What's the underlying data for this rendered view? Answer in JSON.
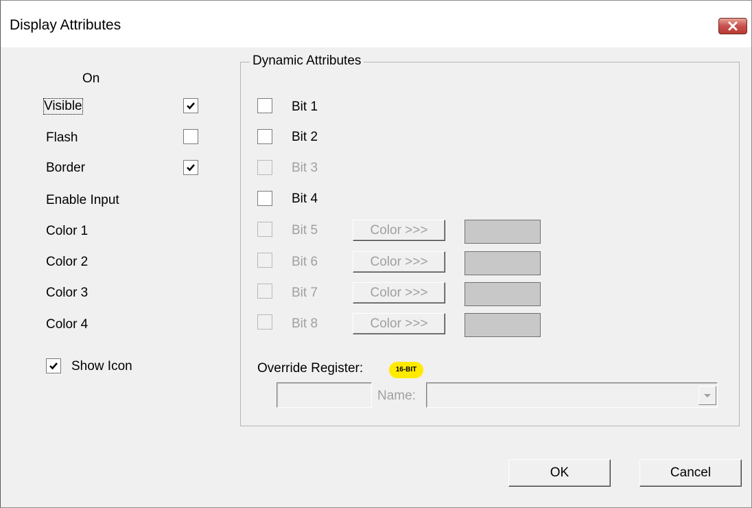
{
  "window": {
    "title": "Display Attributes"
  },
  "left": {
    "on_header": "On",
    "rows": [
      {
        "label": "Visible",
        "checked": true,
        "has_checkbox": true
      },
      {
        "label": "Flash",
        "checked": false,
        "has_checkbox": true
      },
      {
        "label": "Border",
        "checked": true,
        "has_checkbox": true
      },
      {
        "label": "Enable Input",
        "has_checkbox": false
      },
      {
        "label": "Color 1",
        "has_checkbox": false
      },
      {
        "label": "Color 2",
        "has_checkbox": false
      },
      {
        "label": "Color 3",
        "has_checkbox": false
      },
      {
        "label": "Color 4",
        "has_checkbox": false
      }
    ],
    "show_icon": {
      "label": "Show Icon",
      "checked": true
    }
  },
  "dynamic": {
    "title": "Dynamic Attributes",
    "bits": [
      {
        "label": "Bit 1",
        "enabled": true,
        "checked": false
      },
      {
        "label": "Bit 2",
        "enabled": true,
        "checked": false
      },
      {
        "label": "Bit 3",
        "enabled": false,
        "checked": false
      },
      {
        "label": "Bit 4",
        "enabled": true,
        "checked": false
      },
      {
        "label": "Bit 5",
        "enabled": false,
        "checked": false,
        "color_button": "Color >>>"
      },
      {
        "label": "Bit 6",
        "enabled": false,
        "checked": false,
        "color_button": "Color >>>"
      },
      {
        "label": "Bit 7",
        "enabled": false,
        "checked": false,
        "color_button": "Color >>>"
      },
      {
        "label": "Bit 8",
        "enabled": false,
        "checked": false,
        "color_button": "Color >>>"
      }
    ],
    "override_label": "Override Register:",
    "badge": "16-BIT",
    "register_value": "",
    "name_label": "Name:",
    "name_value": ""
  },
  "buttons": {
    "ok": "OK",
    "cancel": "Cancel"
  },
  "colors": {
    "swatch": "#c8c8c8",
    "badge": "#ffea00",
    "close": "#c75050"
  }
}
